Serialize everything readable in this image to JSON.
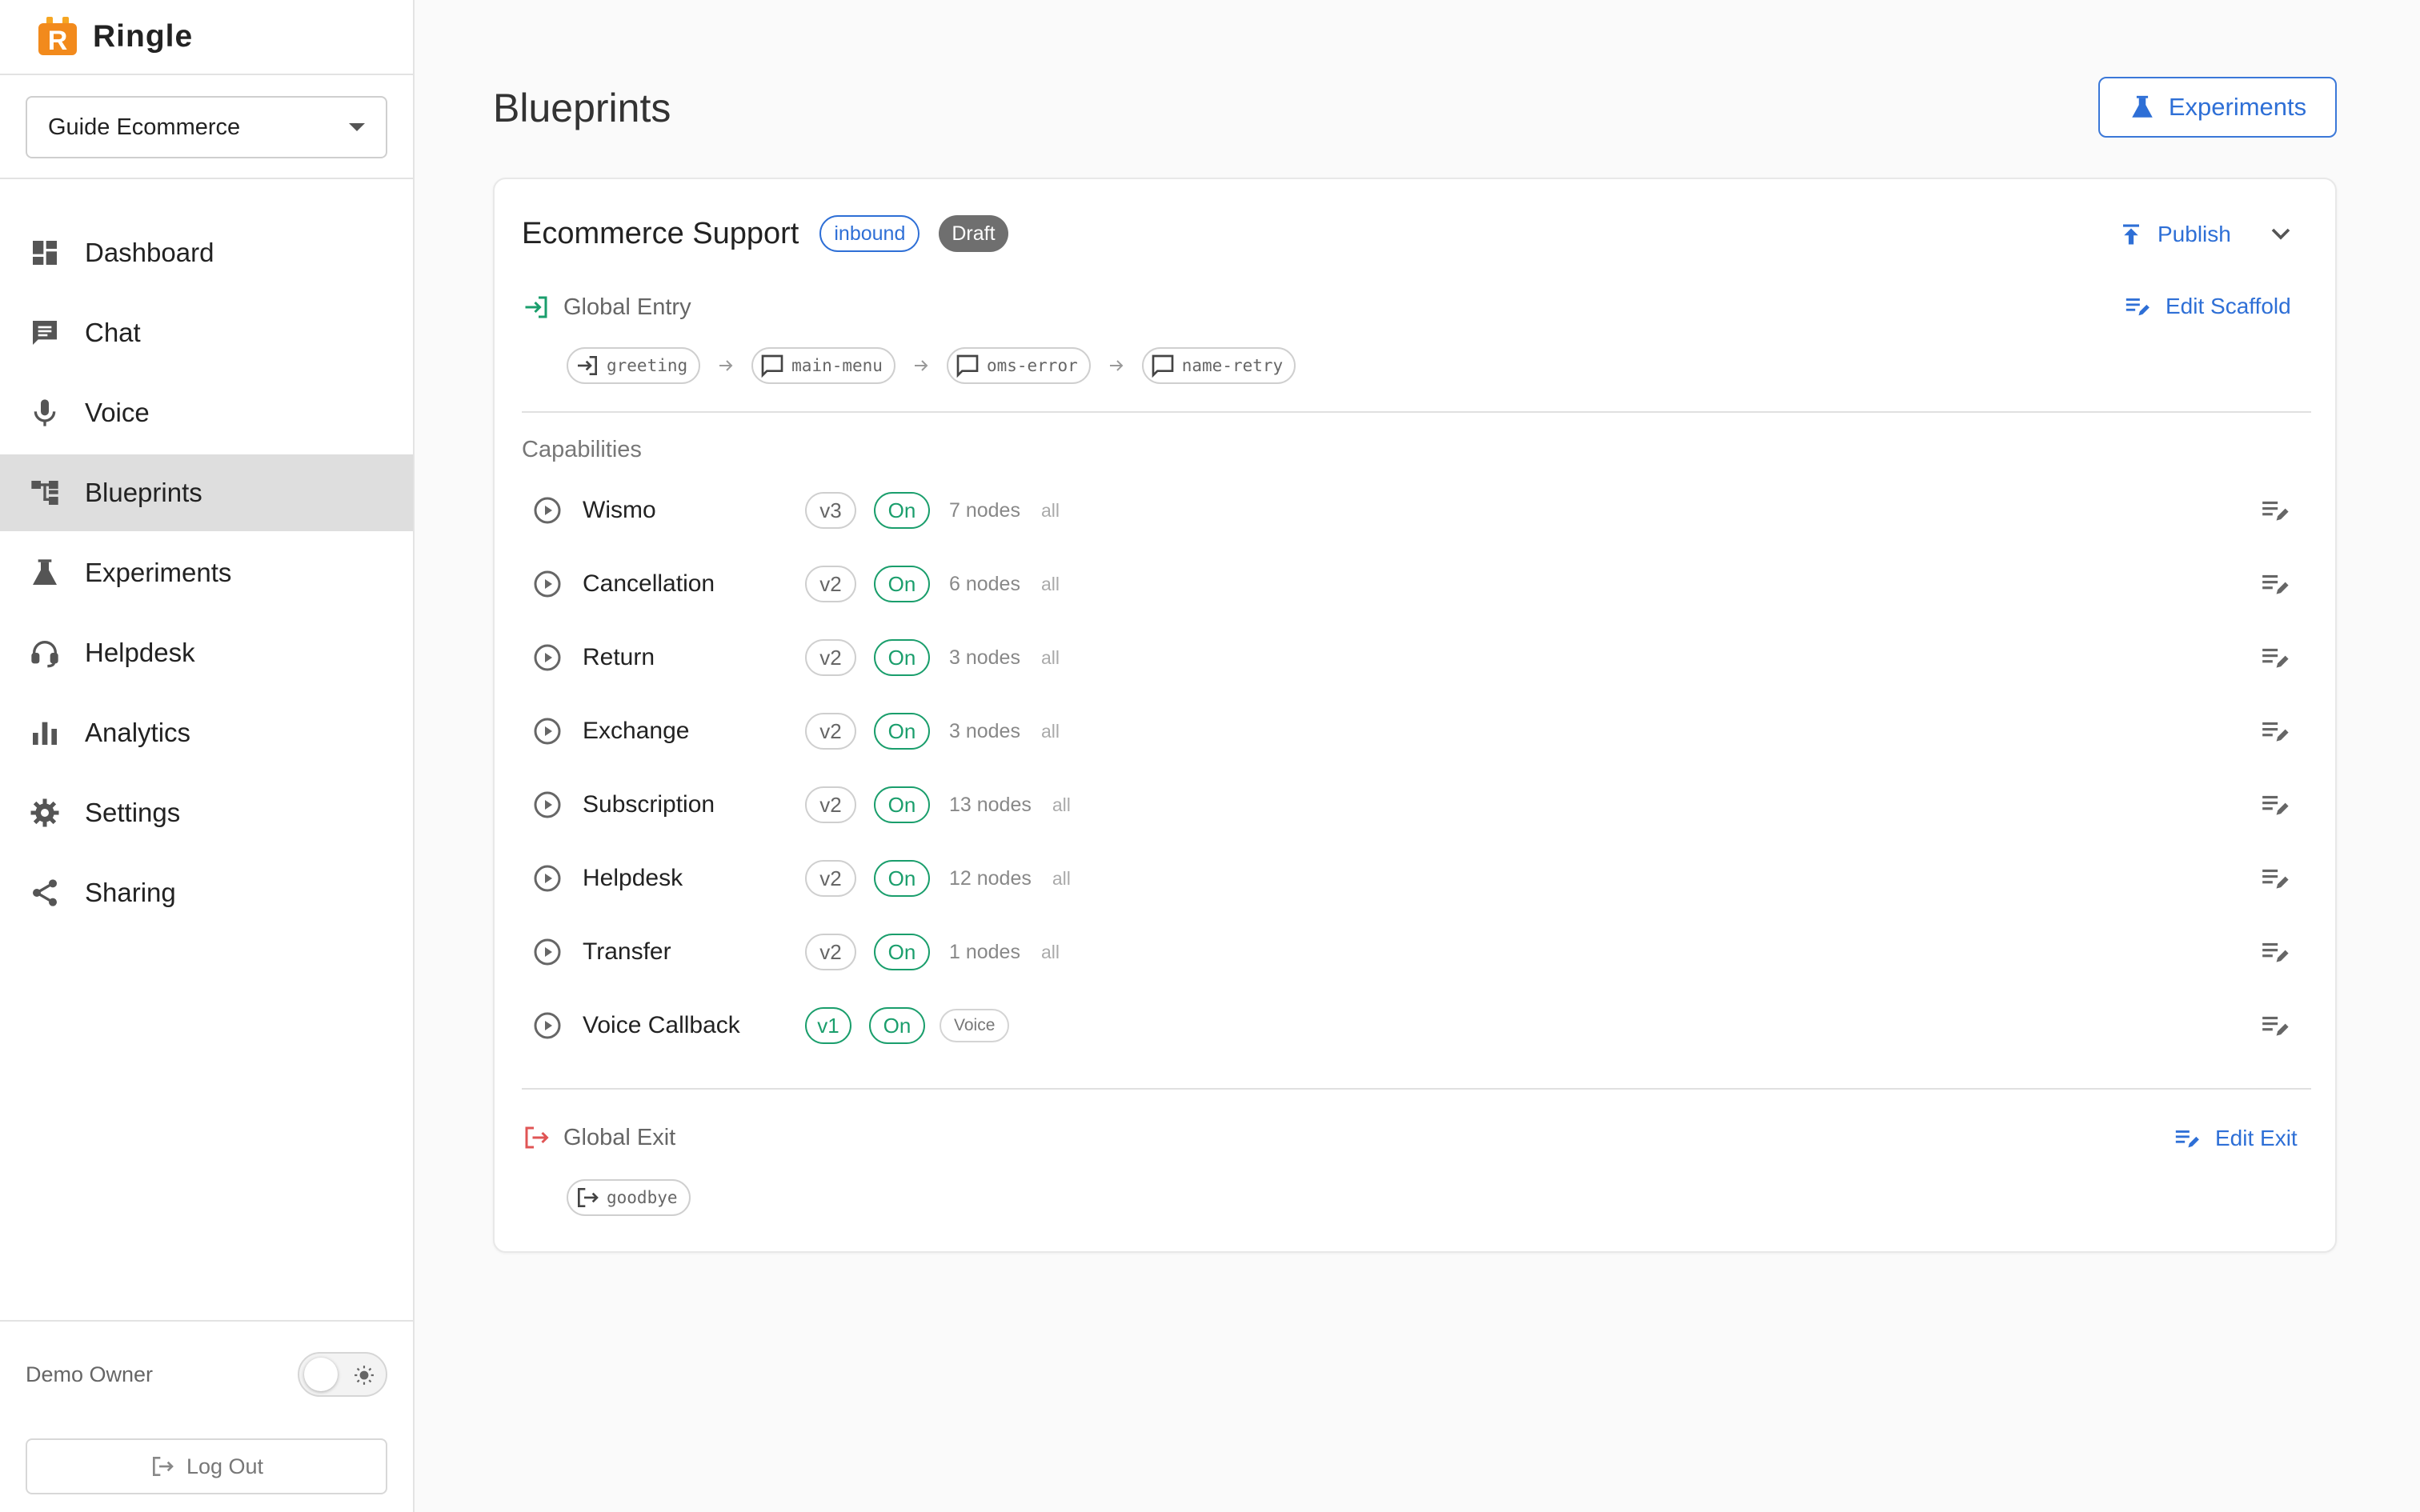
{
  "brand": {
    "name": "Ringle",
    "logo_letter": "R"
  },
  "workspace": {
    "selected": "Guide Ecommerce"
  },
  "sidebar": {
    "items": [
      {
        "label": "Dashboard",
        "icon": "dashboard-icon"
      },
      {
        "label": "Chat",
        "icon": "chat-icon"
      },
      {
        "label": "Voice",
        "icon": "microphone-icon"
      },
      {
        "label": "Blueprints",
        "icon": "blueprints-icon",
        "active": true
      },
      {
        "label": "Experiments",
        "icon": "flask-icon"
      },
      {
        "label": "Helpdesk",
        "icon": "headset-icon"
      },
      {
        "label": "Analytics",
        "icon": "bar-chart-icon"
      },
      {
        "label": "Settings",
        "icon": "gear-icon"
      },
      {
        "label": "Sharing",
        "icon": "share-icon"
      }
    ],
    "footer": {
      "owner": "Demo Owner",
      "logout_label": "Log Out",
      "theme": "light"
    }
  },
  "page": {
    "title": "Blueprints",
    "experiments_button": "Experiments"
  },
  "blueprint": {
    "name": "Ecommerce Support",
    "direction_badge": "inbound",
    "status_badge": "Draft",
    "publish_label": "Publish",
    "global_entry": {
      "label": "Global Entry",
      "edit_label": "Edit Scaffold",
      "flow": [
        {
          "name": "greeting",
          "icon": "entry-icon"
        },
        {
          "name": "main-menu",
          "icon": "message-icon"
        },
        {
          "name": "oms-error",
          "icon": "message-icon"
        },
        {
          "name": "name-retry",
          "icon": "message-icon"
        }
      ]
    },
    "capabilities_label": "Capabilities",
    "capabilities": [
      {
        "name": "Wismo",
        "version": "v3",
        "status": "On",
        "nodes": "7 nodes",
        "scope": "all"
      },
      {
        "name": "Cancellation",
        "version": "v2",
        "status": "On",
        "nodes": "6 nodes",
        "scope": "all"
      },
      {
        "name": "Return",
        "version": "v2",
        "status": "On",
        "nodes": "3 nodes",
        "scope": "all"
      },
      {
        "name": "Exchange",
        "version": "v2",
        "status": "On",
        "nodes": "3 nodes",
        "scope": "all"
      },
      {
        "name": "Subscription",
        "version": "v2",
        "status": "On",
        "nodes": "13 nodes",
        "scope": "all"
      },
      {
        "name": "Helpdesk",
        "version": "v2",
        "status": "On",
        "nodes": "12 nodes",
        "scope": "all"
      },
      {
        "name": "Transfer",
        "version": "v2",
        "status": "On",
        "nodes": "1 nodes",
        "scope": "all"
      },
      {
        "name": "Voice Callback",
        "version": "v1",
        "status": "On",
        "channel": "Voice"
      }
    ],
    "global_exit": {
      "label": "Global Exit",
      "edit_label": "Edit Exit",
      "flow": [
        {
          "name": "goodbye",
          "icon": "exit-icon"
        }
      ]
    }
  },
  "colors": {
    "accent": "#2e6fd6",
    "success": "#1a9e6c",
    "brand": "#f28a1c",
    "danger": "#e05555",
    "active_nav": "#dedede",
    "draft_badge": "#6f6f6f"
  }
}
